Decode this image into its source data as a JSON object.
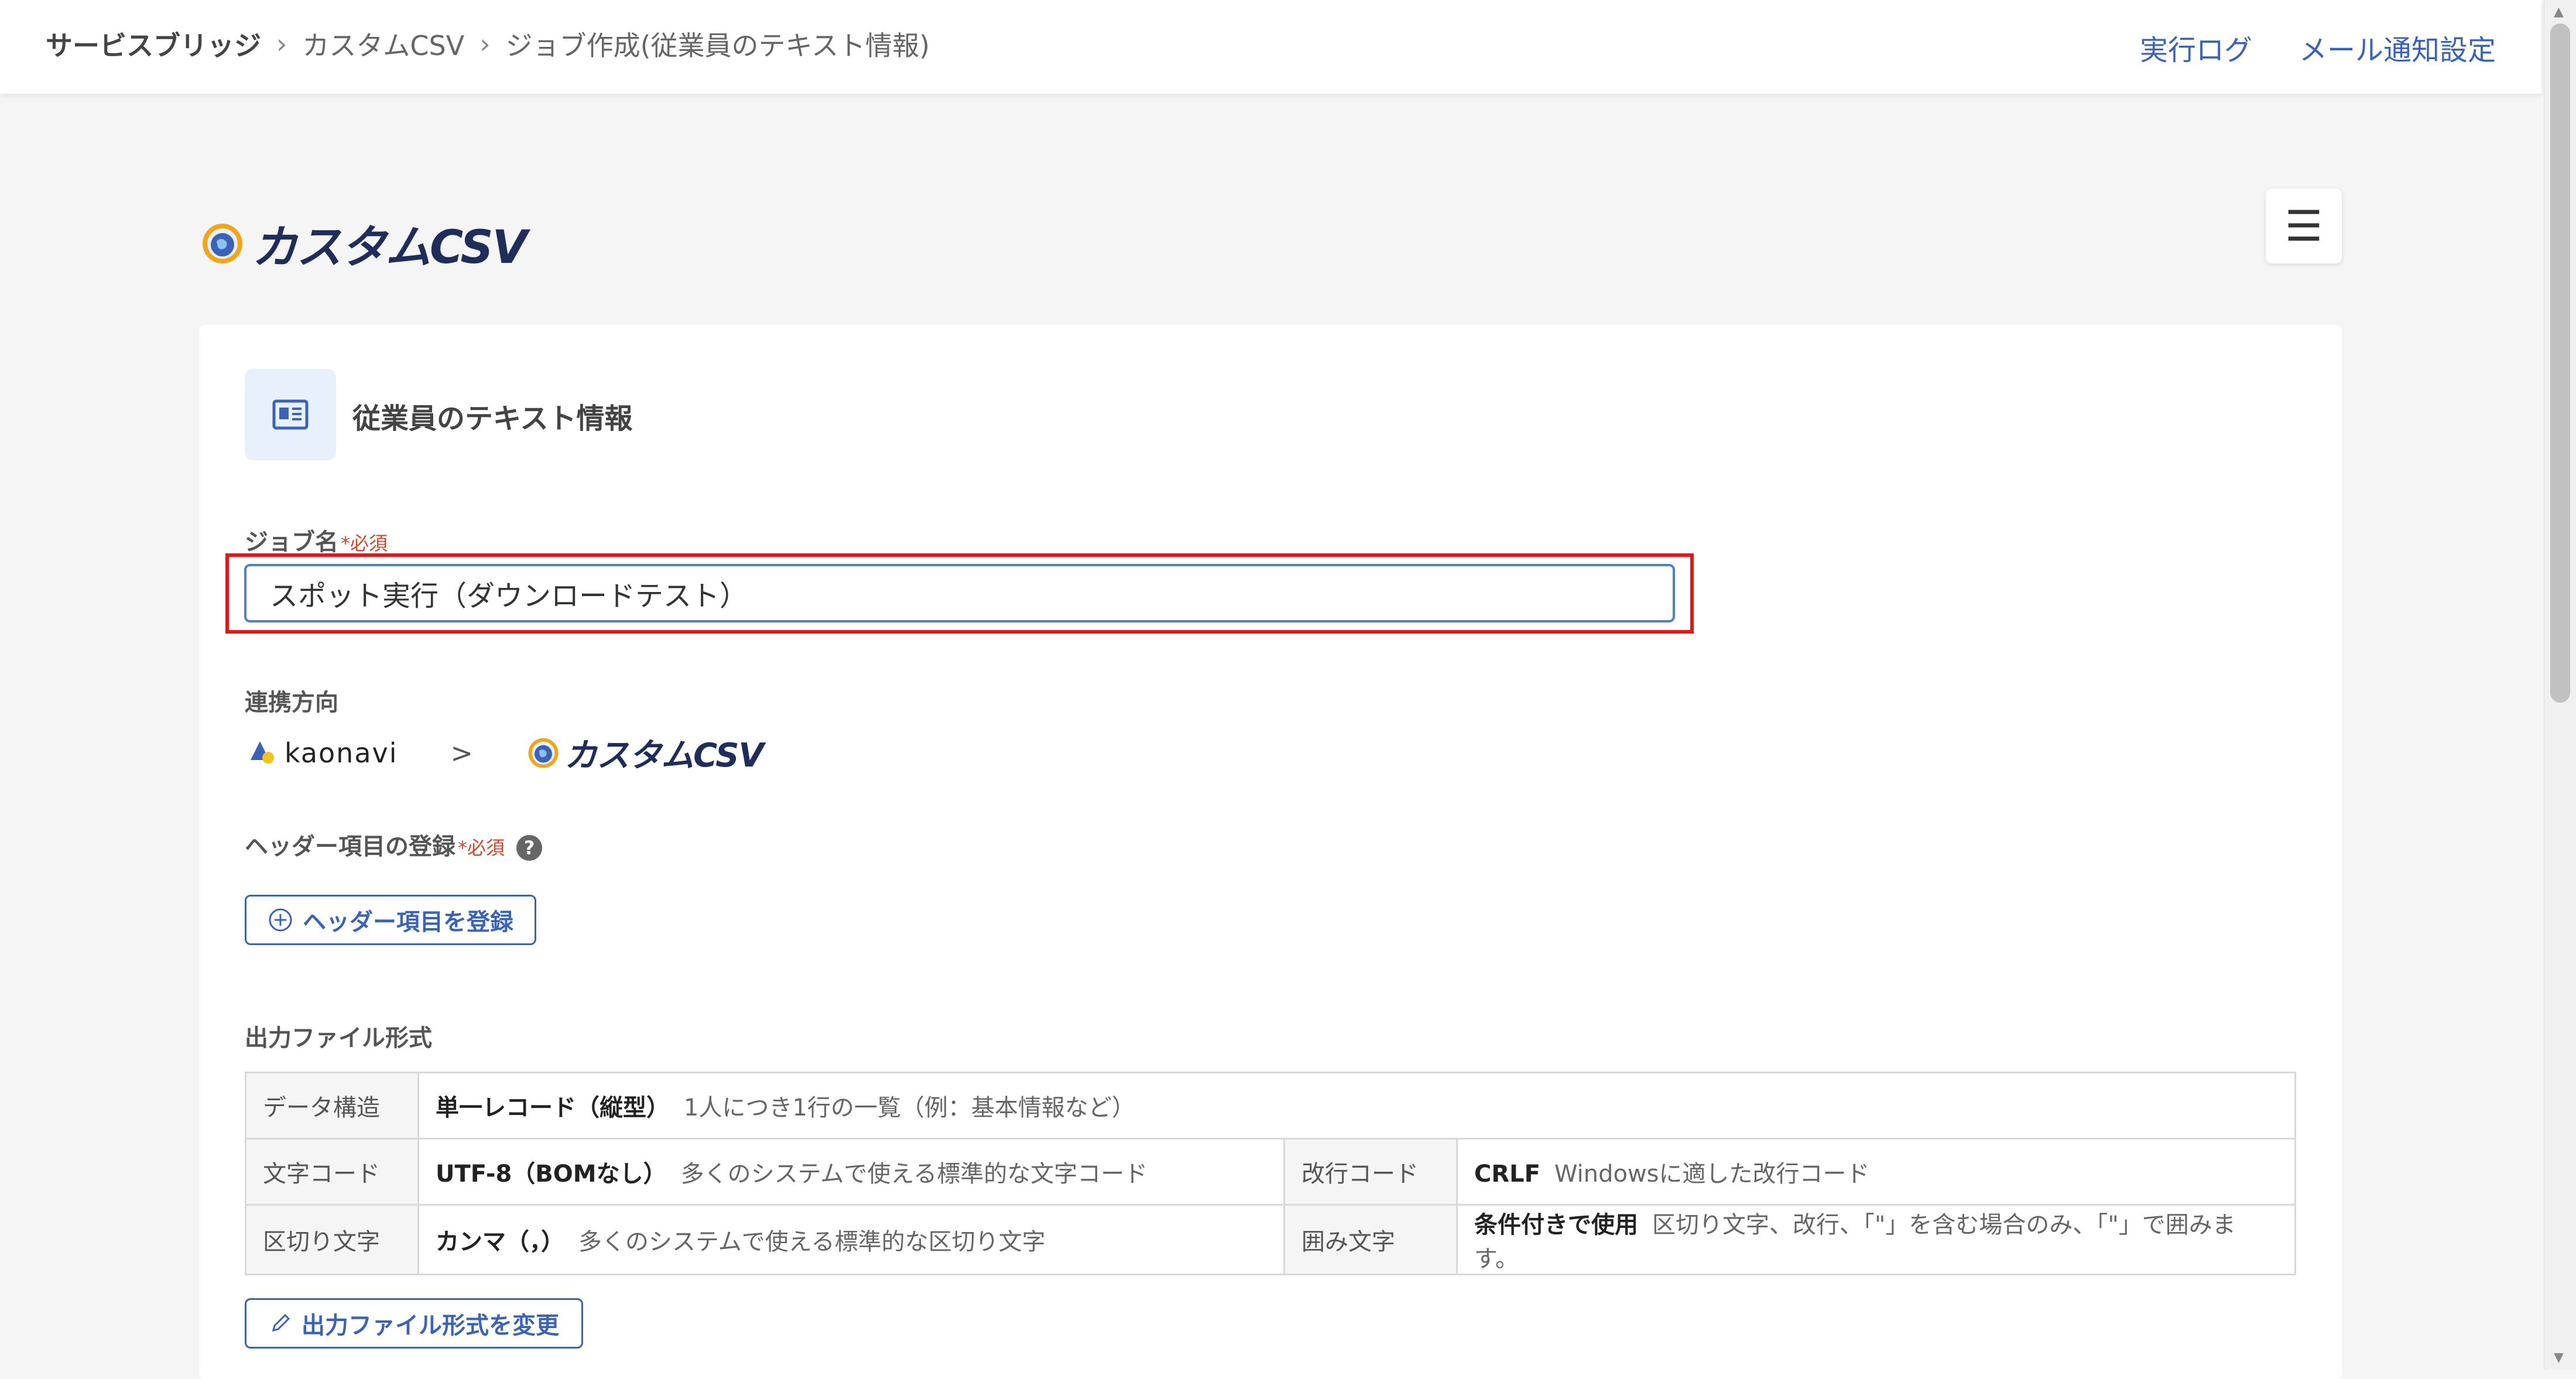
{
  "breadcrumb": {
    "root": "サービスブリッジ",
    "items": [
      "カスタムCSV",
      "ジョブ作成(従業員のテキスト情報)"
    ]
  },
  "header_links": {
    "exec_log": "実行ログ",
    "mail_settings": "メール通知設定"
  },
  "logo": {
    "text": "カスタムCSV"
  },
  "icons": {
    "menu": "hamburger-menu-icon",
    "job": "id-card-icon",
    "help": "question-icon",
    "add": "plus-circle-icon",
    "edit": "pencil-icon"
  },
  "job": {
    "heading": "従業員のテキスト情報",
    "name_label": "ジョブ名",
    "required": "*必須",
    "name_value": "スポット実行（ダウンロードテスト）"
  },
  "direction": {
    "label": "連携方向",
    "from": "kaonavi",
    "sep": ">",
    "to": "カスタムCSV"
  },
  "header_items": {
    "label": "ヘッダー項目の登録",
    "required": "*必須",
    "button": "ヘッダー項目を登録"
  },
  "output_format": {
    "label": "出力ファイル形式",
    "data_structure": {
      "key": "データ構造",
      "value": "単一レコード（縦型）",
      "desc": "1人につき1行の一覧（例：基本情報など）"
    },
    "char_code": {
      "key": "文字コード",
      "value": "UTF-8（BOMなし）",
      "desc": "多くのシステムで使える標準的な文字コード"
    },
    "newline": {
      "key": "改行コード",
      "value": "CRLF",
      "desc": "Windowsに適した改行コード"
    },
    "delimiter": {
      "key": "区切り文字",
      "value": "カンマ（，）",
      "desc": "多くのシステムで使える標準的な区切り文字"
    },
    "quote": {
      "key": "囲み文字",
      "value": "条件付きで使用",
      "desc": "区切り文字、改行、「\"」を含む場合のみ、「\"」で囲みます。"
    },
    "change_button": "出力ファイル形式を変更"
  },
  "colors": {
    "accent": "#3a63b8",
    "highlight": "#e01818",
    "required": "#d2462c"
  }
}
